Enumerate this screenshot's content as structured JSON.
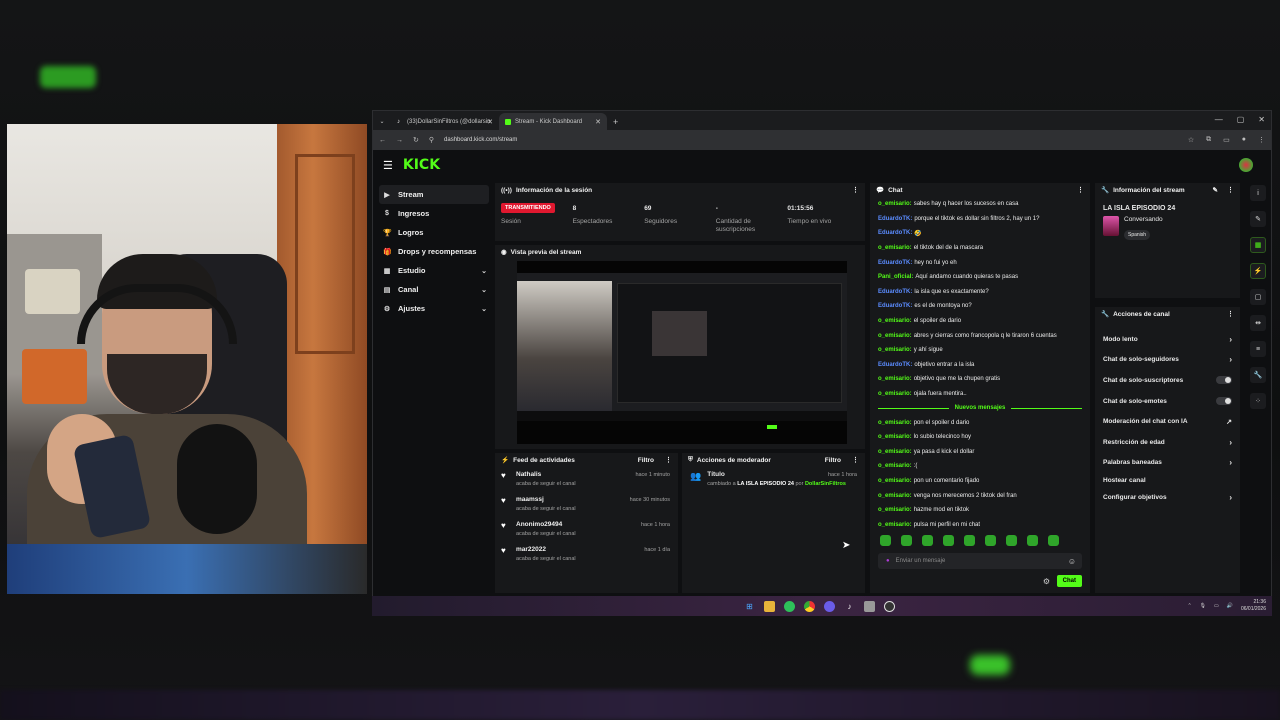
{
  "browser": {
    "tabs": [
      {
        "label": "(33)DollarSinFiltros (@dollarsin",
        "close": "✕"
      },
      {
        "label": "Stream - Kick Dashboard",
        "close": "✕"
      }
    ],
    "new_tab": "+",
    "url": "dashboard.kick.com/stream",
    "window_controls": [
      "—",
      "▢",
      "✕"
    ]
  },
  "kick": {
    "logo": "KICK",
    "sidebar": [
      {
        "icon": "▶",
        "label": "Stream",
        "active": true
      },
      {
        "icon": "$",
        "label": "Ingresos"
      },
      {
        "icon": "🏆",
        "label": "Logros"
      },
      {
        "icon": "🎁",
        "label": "Drops y recompensas"
      },
      {
        "icon": "▦",
        "label": "Estudio",
        "chevron": "⌄"
      },
      {
        "icon": "▤",
        "label": "Canal",
        "chevron": "⌄"
      },
      {
        "icon": "⚙",
        "label": "Ajustes",
        "chevron": "⌄"
      }
    ],
    "session": {
      "title": "Información de la sesión",
      "stats": [
        {
          "value": "TRANSMITIENDO",
          "label": "Sesión"
        },
        {
          "value": "8",
          "label": "Espectadores"
        },
        {
          "value": "69",
          "label": "Seguidores"
        },
        {
          "value": "-",
          "label": "Cantidad de suscripciones"
        },
        {
          "value": "01:15:56",
          "label": "Tiempo en vivo"
        }
      ]
    },
    "preview": {
      "title": "Vista previa del stream"
    },
    "feed": {
      "title": "Feed de actividades",
      "filter": "Filtro",
      "items": [
        {
          "name": "Nathalis",
          "sub": "acaba de seguir el canal",
          "time": "hace 1 minuto"
        },
        {
          "name": "maamssj",
          "sub": "acaba de seguir el canal",
          "time": "hace 30 minutos"
        },
        {
          "name": "Anonimo29494",
          "sub": "acaba de seguir el canal",
          "time": "hace 1 hora"
        },
        {
          "name": "mar22022",
          "sub": "acaba de seguir el canal",
          "time": "hace 1 día"
        }
      ]
    },
    "mod": {
      "title": "Acciones de moderador",
      "filter": "Filtro",
      "item": {
        "title": "Título",
        "time": "hace 1 hora",
        "pre": "cambiado a",
        "value": "LA ISLA EPISODIO 24",
        "by": "por",
        "user": "DollarSinFiltros"
      }
    },
    "chat": {
      "title": "Chat",
      "messages": [
        {
          "user": "o_emisario:",
          "text": "sabes hay q hacer los sucesos en casa",
          "color": "#53fc18"
        },
        {
          "user": "EduardoTK:",
          "text": "porque el tiktok es dollar sin filtros 2, hay un 1?",
          "color": "#5b8cff"
        },
        {
          "user": "EduardoTK:",
          "text": "🤣",
          "color": "#5b8cff"
        },
        {
          "user": "o_emisario:",
          "text": "el tiktok del de la mascara",
          "color": "#53fc18"
        },
        {
          "user": "EduardoTK:",
          "text": "hey no fui yo eh",
          "color": "#5b8cff"
        },
        {
          "user": "Pani_oficial:",
          "text": "Aquí andamo cuando quieras te pasas",
          "color": "#53fc18"
        },
        {
          "user": "EduardoTK:",
          "text": "la isla que es exactamente?",
          "color": "#5b8cff"
        },
        {
          "user": "EduardoTK:",
          "text": "es el de montoya no?",
          "color": "#5b8cff"
        },
        {
          "user": "o_emisario:",
          "text": "el spoiler de dario",
          "color": "#53fc18"
        },
        {
          "user": "o_emisario:",
          "text": "abres y cierras como francopola q le tiraron 6 cuentas",
          "color": "#53fc18"
        },
        {
          "user": "o_emisario:",
          "text": "y ahí sigue",
          "color": "#53fc18"
        },
        {
          "user": "EduardoTK:",
          "text": "objetivo entrar a la isla",
          "color": "#5b8cff"
        },
        {
          "user": "o_emisario:",
          "text": "objetivo que me la chupen gratis",
          "color": "#53fc18"
        },
        {
          "user": "o_emisario:",
          "text": "ojala fuera mentira..",
          "color": "#53fc18"
        }
      ],
      "new_label": "Nuevos mensajes",
      "new_messages": [
        {
          "user": "o_emisario:",
          "text": "pon el spoiler d dario",
          "color": "#53fc18"
        },
        {
          "user": "o_emisario:",
          "text": "lo subio telecinco hoy",
          "color": "#53fc18"
        },
        {
          "user": "o_emisario:",
          "text": "ya pasa d kick el dollar",
          "color": "#53fc18"
        },
        {
          "user": "o_emisario:",
          "text": ":(",
          "color": "#53fc18"
        },
        {
          "user": "o_emisario:",
          "text": "pon un comentario fijado",
          "color": "#53fc18"
        },
        {
          "user": "o_emisario:",
          "text": "venga nos merecemos 2 tiktok del fran",
          "color": "#53fc18"
        },
        {
          "user": "o_emisario:",
          "text": "hazme mod en tiktok",
          "color": "#53fc18"
        },
        {
          "user": "o_emisario:",
          "text": "pulsa mi perfil en mi chat",
          "color": "#53fc18"
        }
      ],
      "input_placeholder": "Enviar un mensaje",
      "send_label": "Chat"
    },
    "stream_info": {
      "title": "Información del stream",
      "stream_title": "LA ISLA EPISODIO 24",
      "category": "Conversando",
      "language": "Spanish"
    },
    "channel_actions": {
      "title": "Acciones de canal",
      "items": [
        {
          "label": "Modo lento",
          "kind": "arrow"
        },
        {
          "label": "Chat de solo-seguidores",
          "kind": "arrow"
        },
        {
          "label": "Chat de solo-suscriptores",
          "kind": "toggle"
        },
        {
          "label": "Chat de solo-emotes",
          "kind": "toggle"
        },
        {
          "label": "Moderación del chat con IA",
          "kind": "ext"
        },
        {
          "label": "Restricción de edad",
          "kind": "arrow"
        },
        {
          "label": "Palabras baneadas",
          "kind": "arrow"
        },
        {
          "label": "Hostear canal",
          "kind": "none"
        },
        {
          "label": "Configurar objetivos",
          "kind": "arrow"
        }
      ]
    }
  },
  "taskbar": {
    "time": "21:36",
    "date": "06/01/2026"
  }
}
